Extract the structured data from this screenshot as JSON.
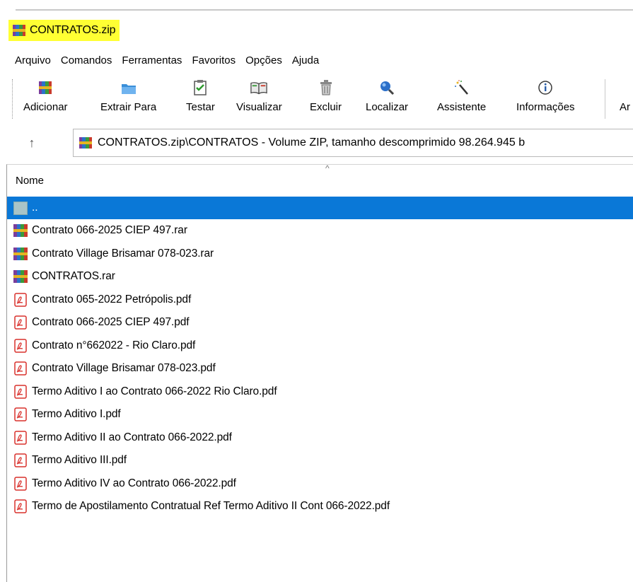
{
  "window": {
    "title": "CONTRATOS.zip"
  },
  "menu": {
    "items": [
      "Arquivo",
      "Comandos",
      "Ferramentas",
      "Favoritos",
      "Opções",
      "Ajuda"
    ]
  },
  "toolbar": {
    "buttons": [
      {
        "label": "Adicionar",
        "icon": "add-archive-icon"
      },
      {
        "label": "Extrair Para",
        "icon": "extract-folder-icon"
      },
      {
        "label": "Testar",
        "icon": "test-clipboard-icon"
      },
      {
        "label": "Visualizar",
        "icon": "view-book-icon"
      },
      {
        "label": "Excluir",
        "icon": "trash-icon"
      },
      {
        "label": "Localizar",
        "icon": "magnifier-icon"
      },
      {
        "label": "Assistente",
        "icon": "wizard-wand-icon"
      },
      {
        "label": "Informações",
        "icon": "info-icon"
      },
      {
        "label": "Ar",
        "icon": ""
      }
    ]
  },
  "address": {
    "up_label": "↑",
    "path": "CONTRATOS.zip\\CONTRATOS - Volume ZIP, tamanho descomprimido 98.264.945 b"
  },
  "list": {
    "column_name": "Nome",
    "rows": [
      {
        "name": "..",
        "type": "up",
        "selected": true
      },
      {
        "name": "Contrato 066-2025 CIEP 497.rar",
        "type": "rar"
      },
      {
        "name": "Contrato Village Brisamar 078-023.rar",
        "type": "rar"
      },
      {
        "name": "CONTRATOS.rar",
        "type": "rar"
      },
      {
        "name": "Contrato 065-2022 Petrópolis.pdf",
        "type": "pdf"
      },
      {
        "name": "Contrato 066-2025 CIEP 497.pdf",
        "type": "pdf"
      },
      {
        "name": "Contrato n°662022 - Rio Claro.pdf",
        "type": "pdf"
      },
      {
        "name": "Contrato Village Brisamar 078-023.pdf",
        "type": "pdf"
      },
      {
        "name": "Termo Aditivo I ao Contrato 066-2022 Rio Claro.pdf",
        "type": "pdf"
      },
      {
        "name": "Termo Aditivo I.pdf",
        "type": "pdf"
      },
      {
        "name": "Termo Aditivo II ao Contrato 066-2022.pdf",
        "type": "pdf"
      },
      {
        "name": "Termo Aditivo III.pdf",
        "type": "pdf"
      },
      {
        "name": "Termo Aditivo IV ao Contrato 066-2022.pdf",
        "type": "pdf"
      },
      {
        "name": "Termo de Apostilamento Contratual Ref Termo Aditivo II Cont 066-2022.pdf",
        "type": "pdf"
      }
    ]
  },
  "colors": {
    "title_highlight": "#ffff33",
    "selection": "#0a78d7",
    "pdf_red": "#d9302c"
  }
}
